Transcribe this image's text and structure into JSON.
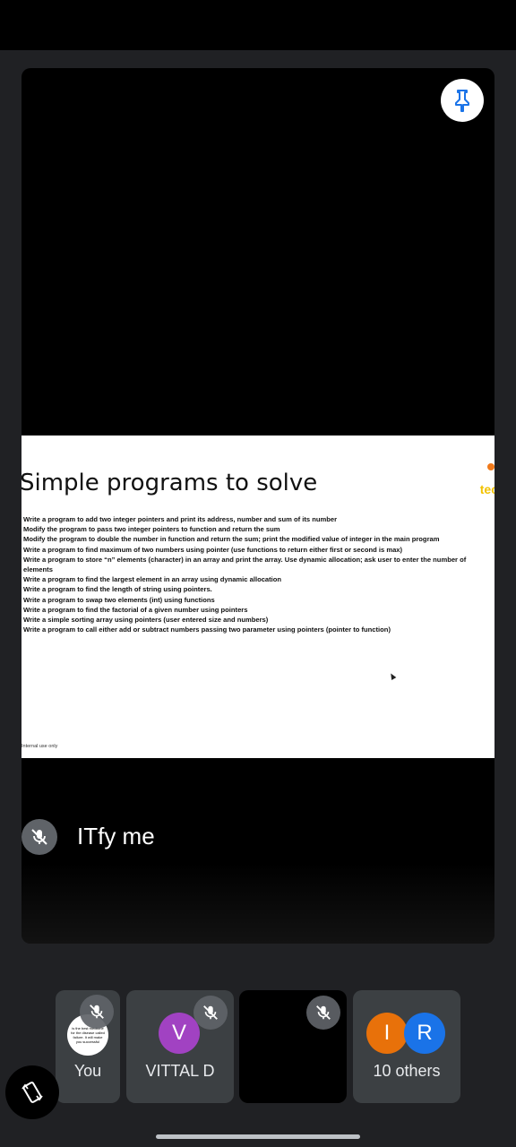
{
  "main_tile": {
    "speaker_name": "ITfy me",
    "pin_icon": "pin-icon",
    "slide": {
      "title": "Simple programs to solve",
      "logo_text": "tec",
      "items": [
        "Write a program to add two integer pointers and print its address, number and sum of its number",
        "Modify the program to pass two integer pointers to function and return the sum",
        "Modify the program to double the number in function and return the sum; print the modified value of integer in the main program",
        "Write a program to find maximum of two numbers using pointer (use functions to return either first or second is max)",
        "Write a program to store “n” elements (character) in an array and print the array. Use dynamic allocation; ask user to enter the number of",
        "elements",
        "Write a program to find the largest element in an array using dynamic allocation",
        "Write a program to find the length of string using pointers.",
        "Write a program to swap two elements (int) using functions",
        "Write a program to find the factorial of a given number using pointers",
        "Write a simple sorting array using pointers (user entered size and numbers)",
        "Write a program to call either add or subtract numbers passing two parameter using pointers (pointer to function)"
      ],
      "footer": "Internal use only"
    }
  },
  "participants": [
    {
      "label": "You",
      "avatar_text": "is the best medicine for the disease called failure. It will make you successful",
      "muted": true
    },
    {
      "label": "VITTAL D",
      "avatar_letter": "V",
      "avatar_color": "#a142c2",
      "muted": true
    },
    {
      "label": "",
      "muted": true
    },
    {
      "label": "10 others",
      "avatar_letters": [
        "I",
        "R"
      ],
      "avatar_colors": [
        "#e8710a",
        "#1a73e8"
      ]
    }
  ],
  "controls": {
    "rotate_icon": "rotate-screen-icon"
  }
}
